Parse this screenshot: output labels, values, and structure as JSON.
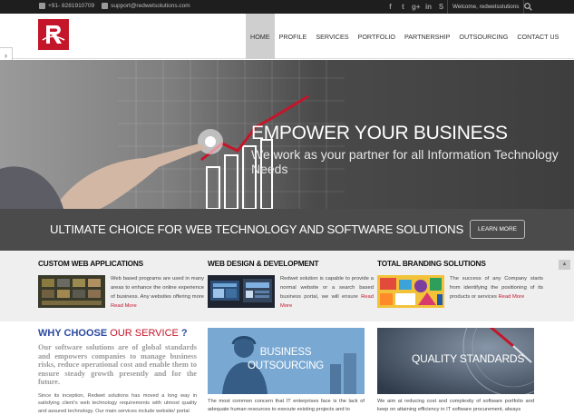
{
  "topbar": {
    "phone": "+91- 8281910709",
    "email": "support@redwetsolutions.com",
    "social_icons": [
      "facebook-icon",
      "twitter-icon",
      "google-plus-icon",
      "linkedin-icon",
      "skype-icon"
    ],
    "social_glyphs": [
      "f",
      "t",
      "g+",
      "in",
      "S"
    ],
    "welcome": "Welcome, redwetsolutions"
  },
  "nav": {
    "items": [
      "HOME",
      "PROFILE",
      "SERVICES",
      "PORTFOLIO",
      "PARTNERSHIP",
      "OUTSOURCING",
      "CONTACT US"
    ],
    "active": "HOME"
  },
  "hero": {
    "headline": "EMPOWER YOUR BUSINESS",
    "subline": "We work as your partner for all Information Technology Needs"
  },
  "band": {
    "title": "ULTIMATE CHOICE FOR WEB TECHNOLOGY AND SOFTWARE SOLUTIONS",
    "button": "LEARN MORE"
  },
  "services": [
    {
      "title": "CUSTOM WEB APPLICATIONS",
      "text": "Web based programs are used in many areas to enhance the online experience of business. Any websites offering more",
      "more": "Read More"
    },
    {
      "title": "WEB DESIGN & DEVELOPMENT",
      "text": "Redwet solution is capable to provide a normal website or a search based business portal, we will ensure",
      "more": "Read More"
    },
    {
      "title": "TOTAL BRANDING SOLUTIONS",
      "text": "The success of any Company starts from identifying the positioning of its products or services",
      "more": "Read More"
    }
  ],
  "why": {
    "heading_a": "WHY CHOOSE",
    "heading_b": "OUR SERVICE",
    "heading_c": "?",
    "lead": "Our software solutions are of global standards and empowers companies to manage business risks, reduce operational cost and enable them to ensure steady growth presently and for the future.",
    "body": "Since its inception, Redwet solutions has moved a long way in satisfying client's web technology requirements with utmost quality and assured technology. Our main services include website/ portal"
  },
  "cards": [
    {
      "label_1": "BUSINESS",
      "label_2": "OUTSOURCING",
      "caption": "The most common concern that IT enterprises face is the lack of adequate human resources to execute existing projects and to"
    },
    {
      "label_1": "QUALITY STANDARDS",
      "caption": "We aim at reducing cost and complexity of software portfolio and keep on attaining efficiency in IT software procurement, always"
    }
  ],
  "colors": {
    "brand_red": "#c4162a",
    "accent_blue": "#2b4aa0",
    "dark_band": "#4b4b4b"
  }
}
